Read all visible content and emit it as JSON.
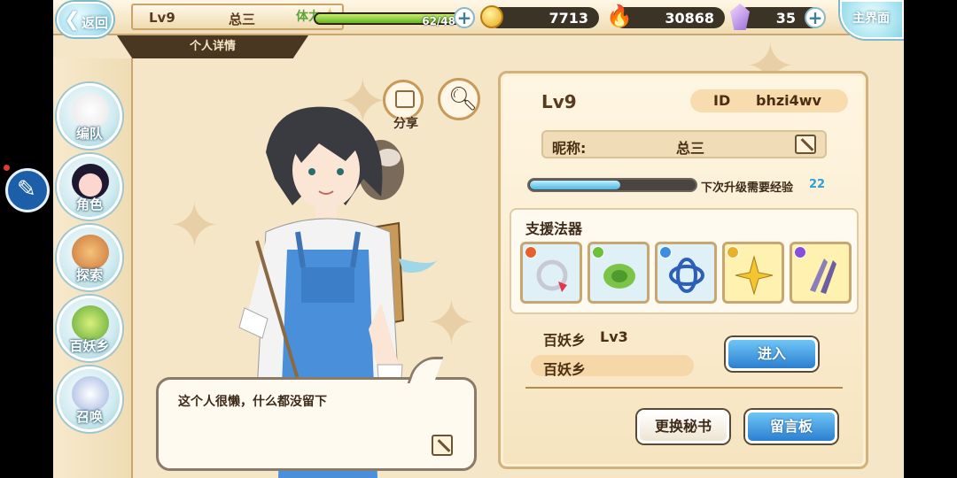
{
  "topbar": {
    "back_label": "返回",
    "level": "Lv9",
    "player_name": "总三",
    "subtitle": "个人详情",
    "stamina_label": "体力",
    "stamina_value": "62/48",
    "stamina_fraction": 1.0,
    "gold": "7713",
    "spirit": "30868",
    "gems": "35",
    "home_label": "主界面"
  },
  "sidenav": {
    "items": [
      {
        "label": "编队",
        "icon": "ghost-team-icon"
      },
      {
        "label": "角色",
        "icon": "character-portrait-icon"
      },
      {
        "label": "探索",
        "icon": "explore-tools-icon"
      },
      {
        "label": "百妖乡",
        "icon": "village-icon"
      },
      {
        "label": "召唤",
        "icon": "summon-swirl-icon"
      }
    ]
  },
  "actions": {
    "share_label": "分享"
  },
  "bubble": {
    "message": "这个人很懒，什么都没留下"
  },
  "profile": {
    "level": "Lv9",
    "id_label": "ID",
    "id_value": "bhzi4wv",
    "nickname_label": "昵称:",
    "nickname_value": "总三",
    "exp_text": "下次升级需要经验",
    "exp_needed": "22",
    "exp_fraction": 0.55,
    "support_title": "支援法器",
    "support_items": [
      {
        "icon": "bracelet-icon",
        "badge_color": "#e8612c",
        "bg": "#dff1f6"
      },
      {
        "icon": "leaf-charm-icon",
        "badge_color": "#6cc13a",
        "bg": "#dff1f6"
      },
      {
        "icon": "blue-ribbon-icon",
        "badge_color": "#3d8de0",
        "bg": "#dff1f6"
      },
      {
        "icon": "golden-lily-icon",
        "badge_color": "#e8b12c",
        "bg": "#fff1b0"
      },
      {
        "icon": "purple-blades-icon",
        "badge_color": "#8a4fd8",
        "bg": "#fff1b0"
      }
    ],
    "village_name": "百妖乡",
    "village_level": "Lv3",
    "village_bar_label": "百妖乡",
    "enter_button": "进入",
    "change_secretary_button": "更换秘书",
    "message_board_button": "留言板"
  }
}
